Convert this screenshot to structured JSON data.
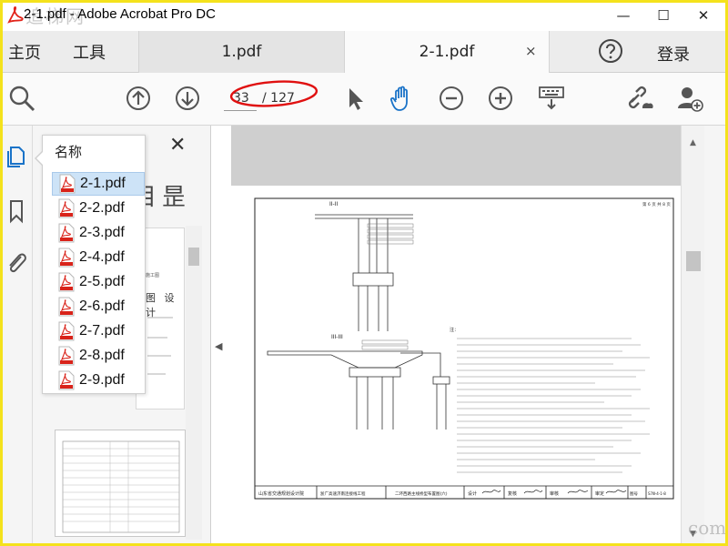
{
  "window": {
    "title": "2-1.pdf - Adobe Acrobat Pro DC",
    "watermark": "追梯网",
    "controls": {
      "minimize": "—",
      "maximize": "☐",
      "close": "✕"
    }
  },
  "tabbar": {
    "home": "主页",
    "tools": "工具",
    "tabs": [
      {
        "label": "1.pdf",
        "active": false
      },
      {
        "label": "2-1.pdf",
        "active": true
      }
    ],
    "close_icon": "×",
    "help_icon": "question-circle-icon",
    "login": "登录"
  },
  "toolbar": {
    "page_current": "33",
    "page_total": "/ 127",
    "icons": [
      "zoom-search-icon",
      "page-up-icon",
      "page-down-icon",
      "select-arrow-icon",
      "hand-tool-icon",
      "zoom-out-icon",
      "zoom-in-icon",
      "keyboard-icon",
      "share-link-icon",
      "add-user-icon"
    ],
    "annotation_color": "#e01010"
  },
  "left_strip": {
    "icons": [
      "attachments-icon",
      "bookmarks-icon",
      "paperclip-icon"
    ]
  },
  "panel": {
    "options_label": "选项",
    "close": "✕",
    "dropdown_header": "名称",
    "files": [
      {
        "name": "2-1.pdf",
        "selected": true
      },
      {
        "name": "2-2.pdf",
        "selected": false
      },
      {
        "name": "2-3.pdf",
        "selected": false
      },
      {
        "name": "2-4.pdf",
        "selected": false
      },
      {
        "name": "2-5.pdf",
        "selected": false
      },
      {
        "name": "2-6.pdf",
        "selected": false
      },
      {
        "name": "2-7.pdf",
        "selected": false
      },
      {
        "name": "2-8.pdf",
        "selected": false
      },
      {
        "name": "2-9.pdf",
        "selected": false
      }
    ],
    "thumb_text": "图 设 计",
    "thumb_small": "施工图"
  },
  "document": {
    "section_top": "II-II",
    "section_mid": "III-III",
    "notes_title": "注：",
    "title_block": {
      "org": "山东省交通规划设计院",
      "project": "浙广高速济南连接线工程",
      "drawing": "二环西路主线桥型布置图(六)",
      "design": "设计",
      "check": "复核",
      "review": "审核",
      "approve": "审定",
      "figno": "图号",
      "figno_val": "S7Ⅲ-4-1-8"
    },
    "sheet_label": "第 6 页 共 8 页"
  },
  "watermark_br": "com"
}
